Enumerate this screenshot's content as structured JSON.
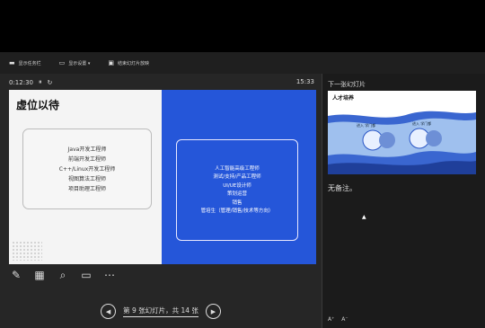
{
  "window": {
    "controls": [
      "⋯",
      "—",
      "❐",
      "✕"
    ]
  },
  "toolbar": {
    "items": [
      {
        "icon": "presenter-icon",
        "label": "显示任务栏"
      },
      {
        "icon": "display-settings-icon",
        "label": "显示设置 ▾"
      },
      {
        "icon": "end-show-icon",
        "label": "结束幻灯片放映"
      }
    ]
  },
  "presenter": {
    "timer": "0:12:30",
    "pause_glyph": "⏸",
    "reset_glyph": "↻",
    "clock": "15:33",
    "slide": {
      "title": "虚位以待",
      "left_items": [
        "Java开发工程师",
        "前端开发工程师",
        "C++/Linux开发工程师",
        "视图算法工程师",
        "项目助理工程师"
      ],
      "right_items": [
        "人工智能高级工程师",
        "测试/支持/产品工程师",
        "UI/UE设计师",
        "策划运营",
        "销售",
        "管培生（管理/销售/技术等方向）"
      ]
    },
    "tools": [
      {
        "name": "pen-icon",
        "glyph": "✎"
      },
      {
        "name": "slides-grid-icon",
        "glyph": "▦"
      },
      {
        "name": "zoom-icon",
        "glyph": "⌕"
      },
      {
        "name": "screen-icon",
        "glyph": "▭"
      },
      {
        "name": "more-options-icon",
        "glyph": "⋯"
      }
    ],
    "nav": {
      "prev_glyph": "◀",
      "next_glyph": "▶",
      "status": "第 9 张幻灯片，共 14 张"
    }
  },
  "side": {
    "next_label": "下一张幻灯片",
    "thumb": {
      "title": "人才培养",
      "card1": "进入 学门都",
      "card2": "进入 学门都"
    },
    "notes": "无备注。",
    "font_inc": "A⁺",
    "font_dec": "A⁻"
  },
  "colors": {
    "slide_blue": "#2556d9",
    "background": "#000000"
  }
}
